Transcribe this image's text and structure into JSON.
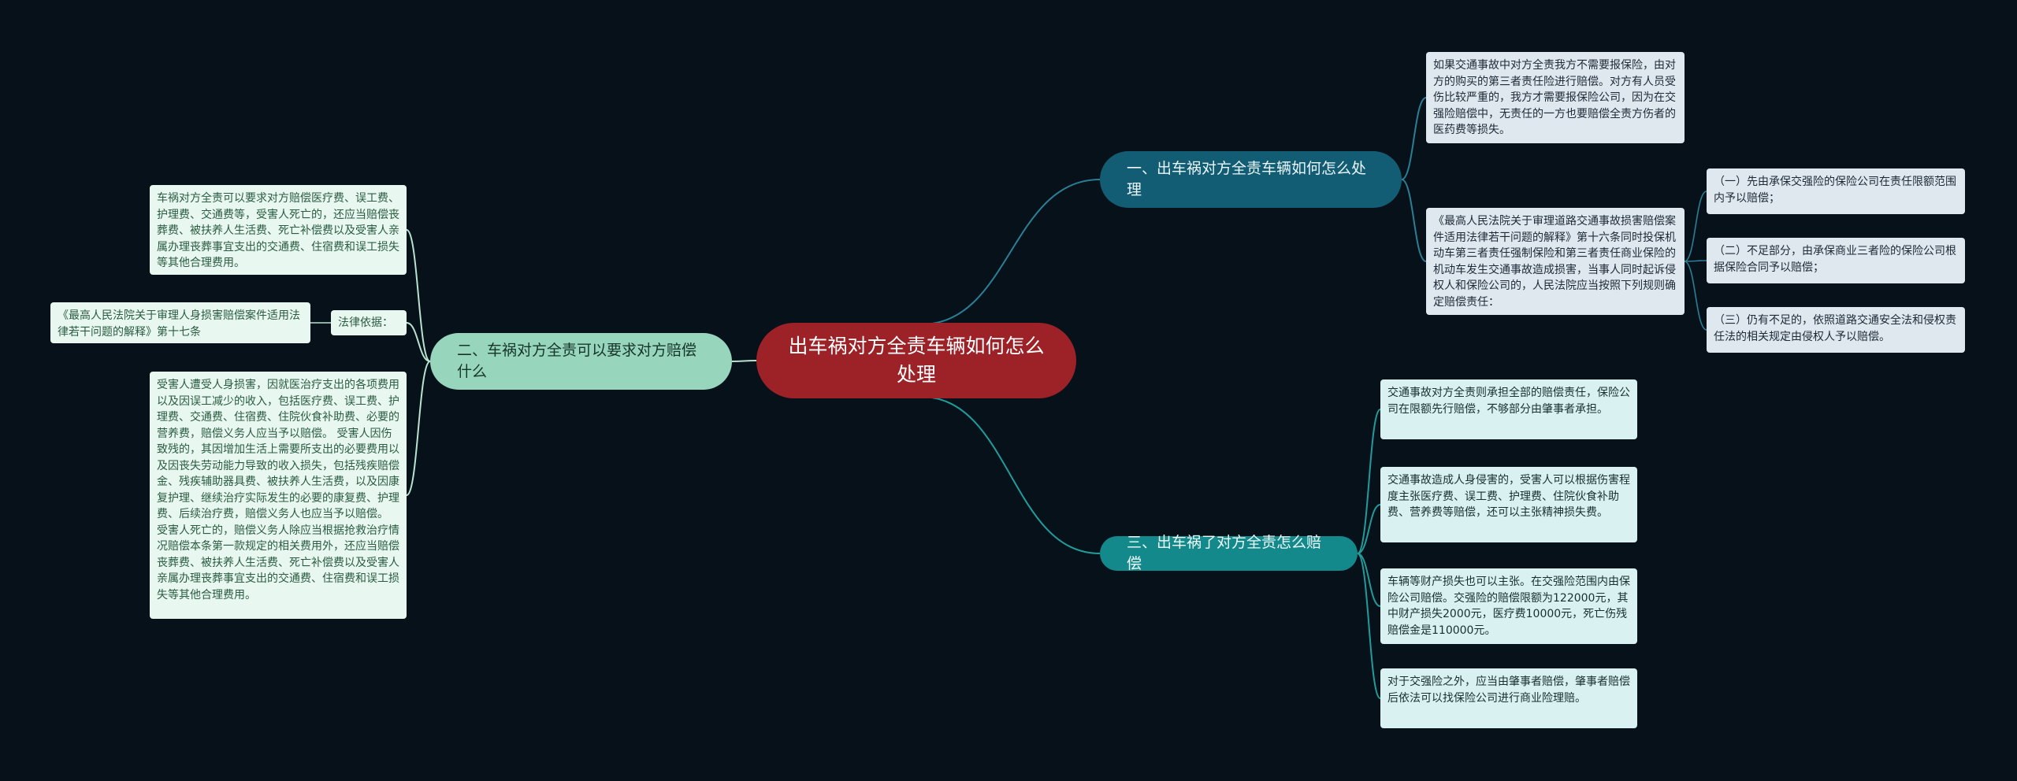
{
  "colors": {
    "background": "#07111a",
    "root": "#9c2228",
    "branch1": "#125d73",
    "branch2": "#97d6bd",
    "branch3": "#14898b",
    "link1": "#2b7f95",
    "link2": "#b8e3cf",
    "link3": "#1f9c9b"
  },
  "root": {
    "label": "出车祸对方全责车辆如何怎么处理"
  },
  "branch1": {
    "label": "一、出车祸对方全责车辆如何怎么处理",
    "leaf1": "如果交通事故中对方全责我方不需要报保险，由对方的购买的第三者责任险进行赔偿。对方有人员受伤比较严重的，我方才需要报保险公司，因为在交强险赔偿中，无责任的一方也要赔偿全责方伤者的医药费等损失。",
    "leaf2": "《最高人民法院关于审理道路交通事故损害赔偿案件适用法律若干问题的解释》第十六条同时投保机动车第三者责任强制保险和第三者责任商业保险的机动车发生交通事故造成损害，当事人同时起诉侵权人和保险公司的，人民法院应当按照下列规则确定赔偿责任：",
    "sub1": "（一）先由承保交强险的保险公司在责任限额范围内予以赔偿；",
    "sub2": "（二）不足部分，由承保商业三者险的保险公司根据保险合同予以赔偿；",
    "sub3": "（三）仍有不足的，依照道路交通安全法和侵权责任法的相关规定由侵权人予以赔偿。"
  },
  "branch2": {
    "label": "二、车祸对方全责可以要求对方赔偿什么",
    "leaf1": "车祸对方全责可以要求对方赔偿医疗费、误工费、护理费、交通费等，受害人死亡的，还应当赔偿丧葬费、被扶养人生活费、死亡补偿费以及受害人亲属办理丧葬事宜支出的交通费、住宿费和误工损失等其他合理费用。",
    "law_tag": "法律依据：",
    "law_ref": "《最高人民法院关于审理人身损害赔偿案件适用法律若干问题的解释》第十七条",
    "leaf3": "受害人遭受人身损害，因就医治疗支出的各项费用以及因误工减少的收入，包括医疗费、误工费、护理费、交通费、住宿费、住院伙食补助费、必要的营养费，赔偿义务人应当予以赔偿。 受害人因伤致残的，其因增加生活上需要所支出的必要费用以及因丧失劳动能力导致的收入损失，包括残疾赔偿金、残疾辅助器具费、被扶养人生活费，以及因康复护理、继续治疗实际发生的必要的康复费、护理费、后续治疗费，赔偿义务人也应当予以赔偿。 受害人死亡的，赔偿义务人除应当根据抢救治疗情况赔偿本条第一款规定的相关费用外，还应当赔偿丧葬费、被扶养人生活费、死亡补偿费以及受害人亲属办理丧葬事宜支出的交通费、住宿费和误工损失等其他合理费用。"
  },
  "branch3": {
    "label": "三、出车祸了对方全责怎么赔偿",
    "leaf1": "交通事故对方全责则承担全部的赔偿责任，保险公司在限额先行赔偿，不够部分由肇事者承担。",
    "leaf2": "交通事故造成人身侵害的，受害人可以根据伤害程度主张医疗费、误工费、护理费、住院伙食补助费、营养费等赔偿，还可以主张精神损失费。",
    "leaf3": "车辆等财产损失也可以主张。在交强险范围内由保险公司赔偿。交强险的赔偿限额为122000元，其中财产损失2000元，医疗费10000元，死亡伤残赔偿金是110000元。",
    "leaf4": "对于交强险之外，应当由肇事者赔偿，肇事者赔偿后依法可以找保险公司进行商业险理赔。"
  }
}
